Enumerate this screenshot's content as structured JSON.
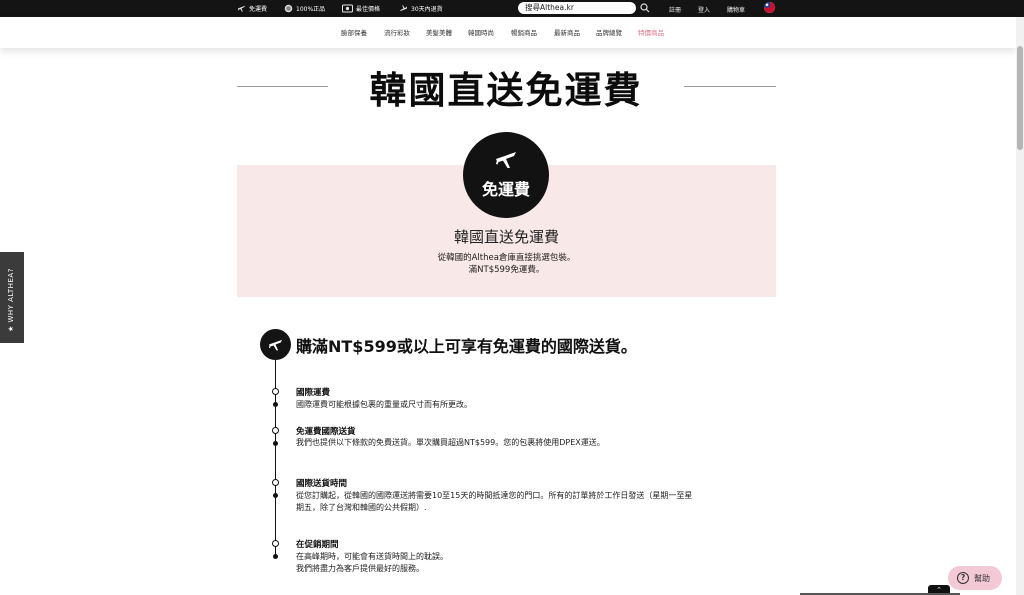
{
  "topbar": {
    "features": [
      {
        "icon": "plane-icon",
        "label": "免運費"
      },
      {
        "icon": "authentic-badge-icon",
        "label": "100%正品"
      },
      {
        "icon": "price-tag-icon",
        "label": "最佳價格"
      },
      {
        "icon": "return-plane-icon",
        "label": "30天內退貨"
      }
    ],
    "search_placeholder": "搜尋Althea.kr",
    "links": {
      "register": "註冊",
      "login": "登入",
      "cart": "購物車"
    }
  },
  "nav": {
    "categories": [
      "臉部保養",
      "流行彩妝",
      "美髮美體",
      "韓國時尚",
      "暢銷商品",
      "最新商品",
      "品牌總覽",
      "特價商品"
    ]
  },
  "hero": {
    "title": "韓國直送免運費",
    "badge_text": "免運費",
    "card_title": "韓國直送免運費",
    "card_line1": "從韓國的Althea倉庫直接挑選包裝。",
    "card_line2": "滿NT$599免運費。"
  },
  "sidetab": {
    "label": "★ WHY ALTHEA?"
  },
  "shipping": {
    "title": "購滿NT$599或以上可享有免運費的國際送貨。",
    "items": [
      {
        "title": "國際運費",
        "text": "國際運費可能根據包裹的重量或尺寸而有所更改。"
      },
      {
        "title": "免運費國際送貨",
        "text": "我們也提供以下條款的免費送貨。單次購買超過NT$599。您的包裹將使用DPEX運送。"
      },
      {
        "title": "國際送貨時間",
        "text1": "從您訂購起，從韓國的國際運送將需要10至15天的時間抵達您的門口。所有的訂單將於工作日發送（星期一至星",
        "text2": "期五，除了台灣和韓國的公共假期）."
      },
      {
        "title": "在促銷期間",
        "text1": "在高峰期時，可能會有送貨時間上的耽誤。",
        "text2": "我們將盡力為客戶提供最好的服務。"
      }
    ]
  },
  "help": {
    "label": "幫助"
  },
  "colors": {
    "accent_pink": "#d9708c",
    "card_bg": "#f8e9e8",
    "dark": "#141414"
  }
}
